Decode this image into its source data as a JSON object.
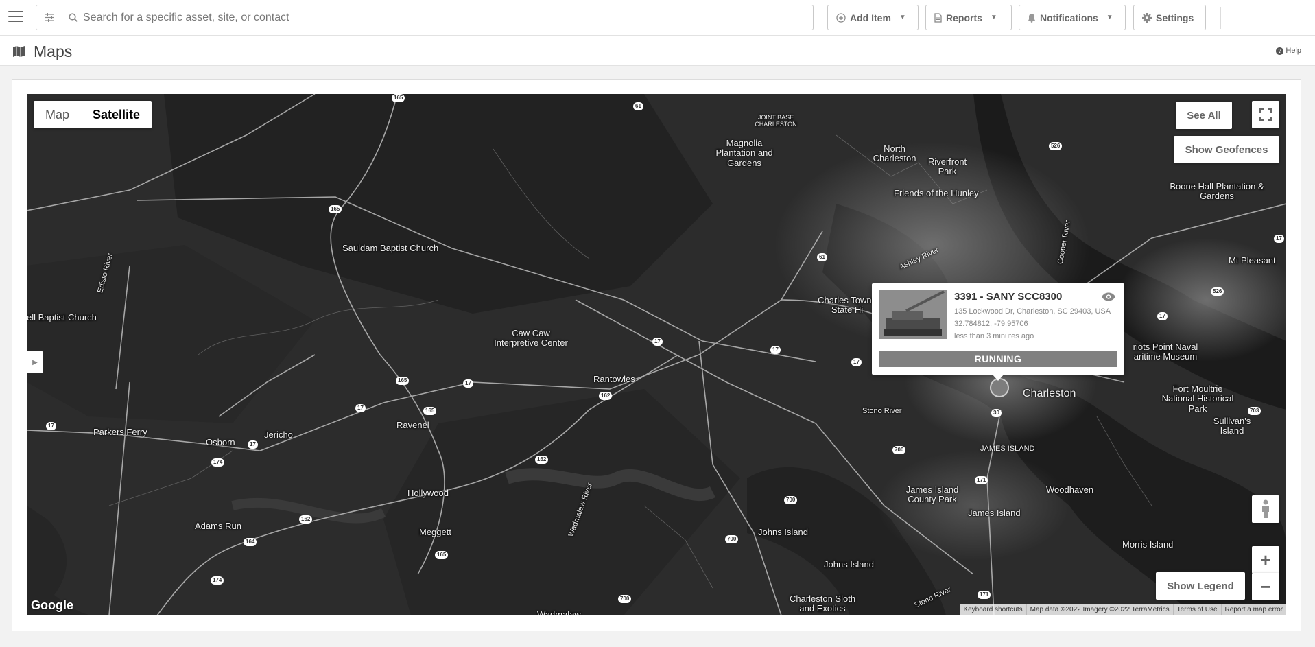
{
  "topbar": {
    "search_placeholder": "Search for a specific asset, site, or contact",
    "add_item_label": "Add Item",
    "reports_label": "Reports",
    "notifications_label": "Notifications",
    "settings_label": "Settings"
  },
  "page": {
    "title": "Maps",
    "help_label": "Help"
  },
  "map": {
    "type_map_label": "Map",
    "type_satellite_label": "Satellite",
    "see_all_label": "See All",
    "show_geofences_label": "Show Geofences",
    "show_legend_label": "Show Legend",
    "zoom_in_label": "+",
    "zoom_out_label": "−",
    "google_logo": "Google",
    "attribution": {
      "keyboard": "Keyboard shortcuts",
      "mapdata": "Map data ©2022 Imagery ©2022 TerraMetrics",
      "terms": "Terms of Use",
      "report": "Report a map error"
    },
    "places": {
      "joint_base": "JOINT BASE CHARLESTON",
      "north_charleston": "North Charleston",
      "magnolia": "Magnolia Plantation and Gardens",
      "riverfront": "Riverfront Park",
      "friends_hunley": "Friends of the Hunley",
      "boone_hall": "Boone Hall Plantation & Gardens",
      "mt_pleasant": "Mt Pleasant",
      "sauldam": "Sauldam Baptist Church",
      "bell_baptist": "ell Baptist Church",
      "caw_caw": "Caw Caw Interpretive Center",
      "rantowles": "Rantowles",
      "charles_towne": "Charles Towne State Hi",
      "patriots_point": "riots Point Naval aritime Museum",
      "charleston": "Charleston",
      "fort_moultrie": "Fort Moultrie National Historical Park",
      "sullivans": "Sullivan's Island",
      "stono": "Stono River",
      "james_island_caps": "JAMES ISLAND",
      "woodhaven": "Woodhaven",
      "james_island_park": "James Island County Park",
      "james_island": "James Island",
      "parkers_ferry": "Parkers Ferry",
      "osborn": "Osborn",
      "jericho": "Jericho",
      "ravenel": "Ravenel",
      "hollywood": "Hollywood",
      "adams_run": "Adams Run",
      "meggett": "Meggett",
      "johns_island_1": "Johns Island",
      "johns_island_2": "Johns Island",
      "morris_island": "Morris Island",
      "charleston_sloth": "Charleston Sloth and Exotics",
      "wadmalaw": "Wadmalaw",
      "ashley_river": "Ashley River",
      "cooper_river": "Cooper River",
      "edisto_river": "Edisto River",
      "wadmalaw_river": "Wadmalaw River",
      "stono_river_2": "Stono River"
    }
  },
  "asset_popup": {
    "title": "3391 - SANY SCC8300",
    "address": "135 Lockwood Dr, Charleston, SC 29403, USA",
    "coords": "32.784812, -79.95706",
    "last_seen": "less than 3 minutes ago",
    "status": "RUNNING"
  },
  "icons": {
    "menu": "menu-icon",
    "filter": "sliders-icon",
    "search": "search-icon",
    "add": "plus-circle-icon",
    "reports": "file-icon",
    "bell": "bell-icon",
    "gear": "gear-icon",
    "map": "map-icon",
    "help": "question-circle-icon",
    "eye": "eye-icon",
    "fullscreen": "fullscreen-icon",
    "pegman": "pegman-icon"
  }
}
